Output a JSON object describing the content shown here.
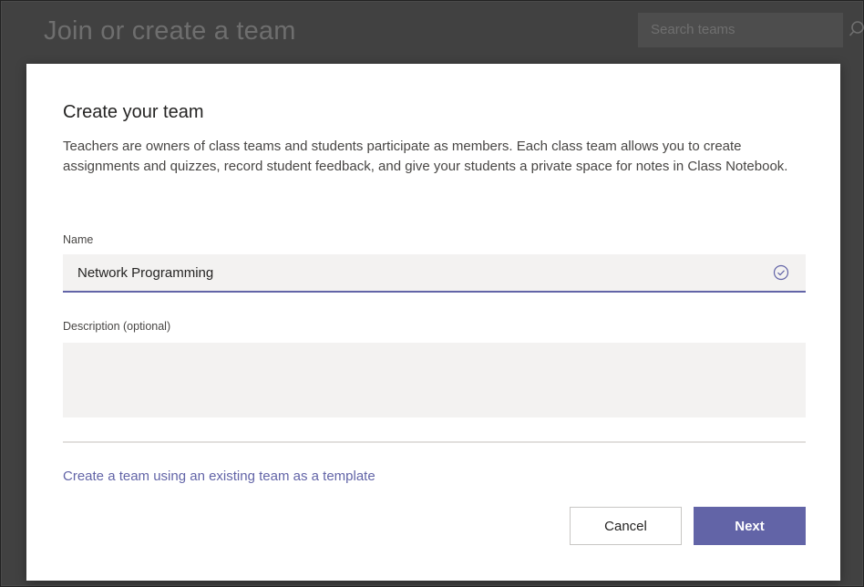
{
  "background": {
    "title": "Join or create a team",
    "search_placeholder": "Search teams"
  },
  "dialog": {
    "title": "Create your team",
    "description": "Teachers are owners of class teams and students participate as members. Each class team allows you to create assignments and quizzes, record student feedback, and give your students a private space for notes in Class Notebook.",
    "name_label": "Name",
    "name_value": "Network Programming",
    "description_label": "Description (optional)",
    "description_value": "",
    "template_link": "Create a team using an existing team as a template",
    "cancel_label": "Cancel",
    "next_label": "Next"
  },
  "colors": {
    "accent": "#6264a7",
    "field_bg": "#f3f2f1",
    "overlay": "#414141"
  }
}
